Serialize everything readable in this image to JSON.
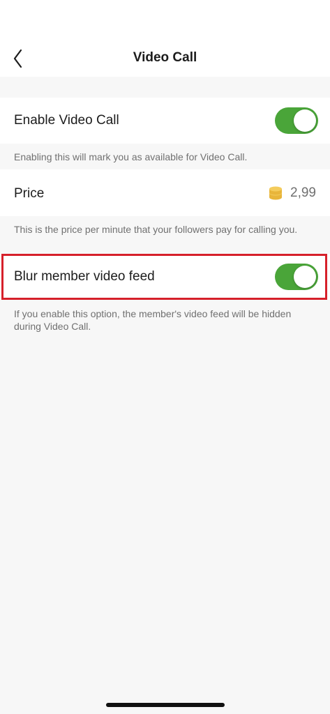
{
  "header": {
    "title": "Video Call",
    "back_icon": "chevron-left-icon"
  },
  "enable_video_call": {
    "label": "Enable Video Call",
    "enabled": true,
    "hint": "Enabling this will mark you as available for Video Call."
  },
  "price": {
    "label": "Price",
    "coin_icon": "coins-icon",
    "value": "2,99",
    "hint": "This is the price per minute that your followers pay for calling you."
  },
  "blur_feed": {
    "label": "Blur member video feed",
    "enabled": true,
    "hint": "If you enable this option, the member's video feed will be hidden during Video Call."
  },
  "colors": {
    "toggle_on": "#4aa539",
    "highlight": "#d6202a",
    "coin": "#e8b53a"
  }
}
